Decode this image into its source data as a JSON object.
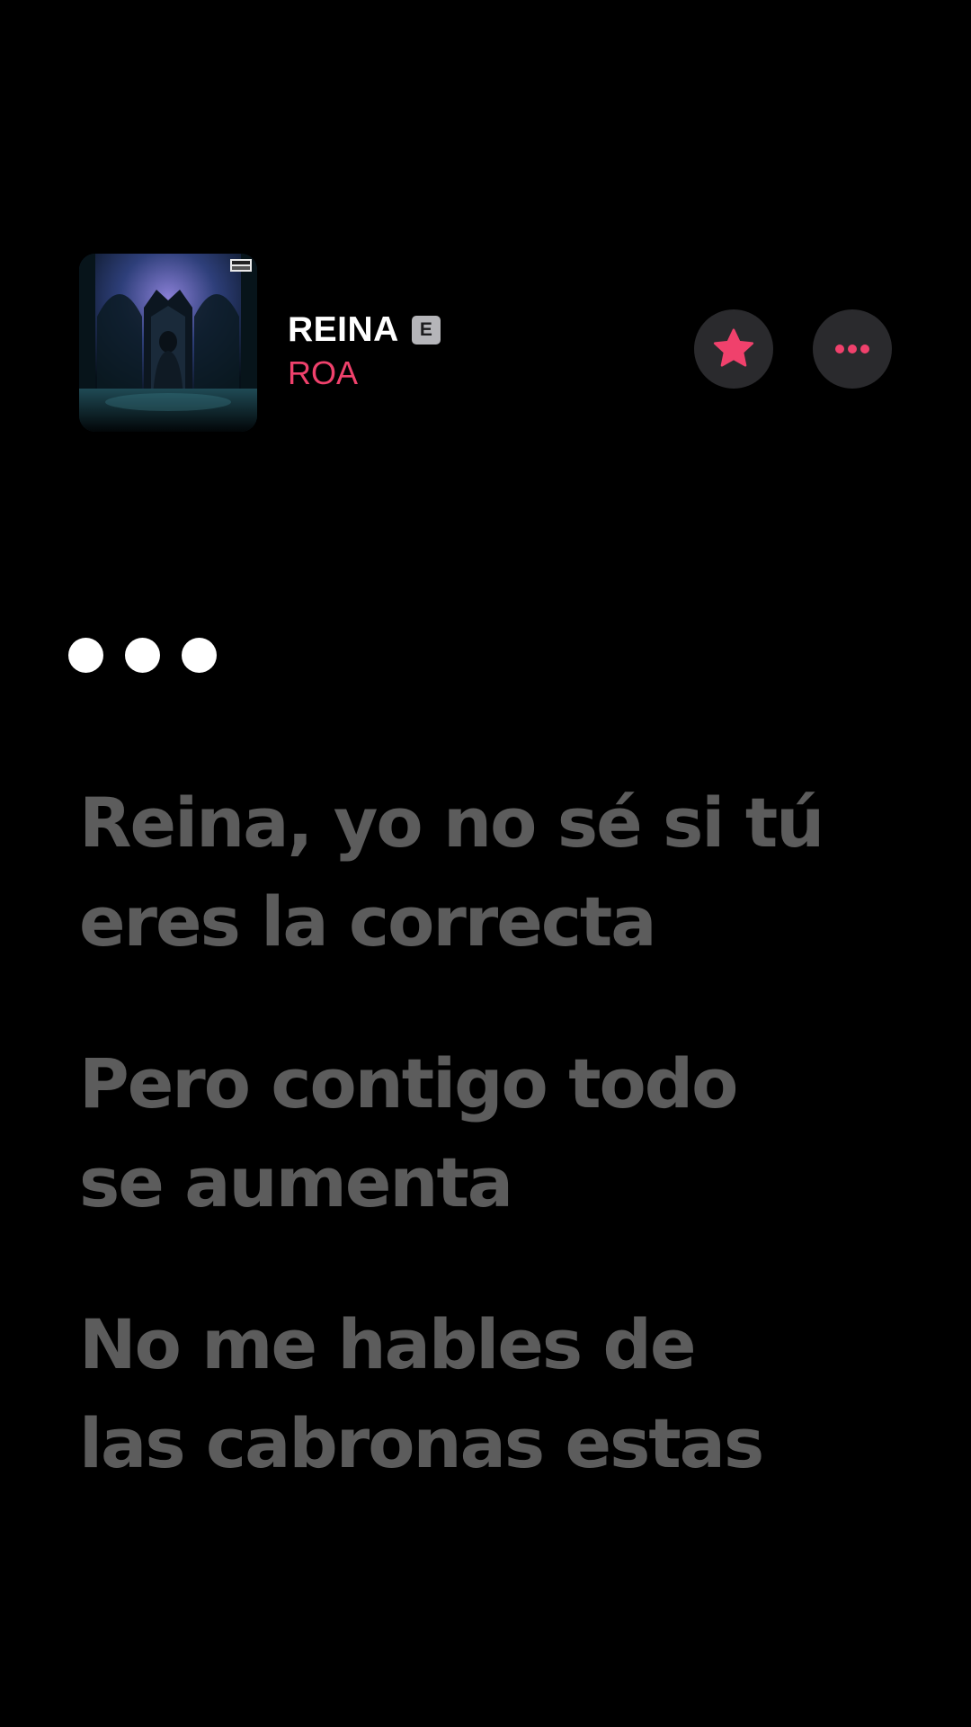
{
  "now_playing": {
    "title": "REINA",
    "explicit_badge": "E",
    "artist": "ROA"
  },
  "actions": {
    "favorite_icon": "star-icon",
    "more_icon": "ellipsis-icon"
  },
  "colors": {
    "accent": "#f0416c",
    "lyric_inactive": "#5c5c5c",
    "background": "#000000"
  },
  "lyrics": [
    {
      "line1": "Reina, yo no sé si tú",
      "line2": "eres la correcta"
    },
    {
      "line1": "Pero contigo todo",
      "line2": "se aumenta"
    },
    {
      "line1": "No me hables de",
      "line2": "las cabronas estas"
    }
  ]
}
